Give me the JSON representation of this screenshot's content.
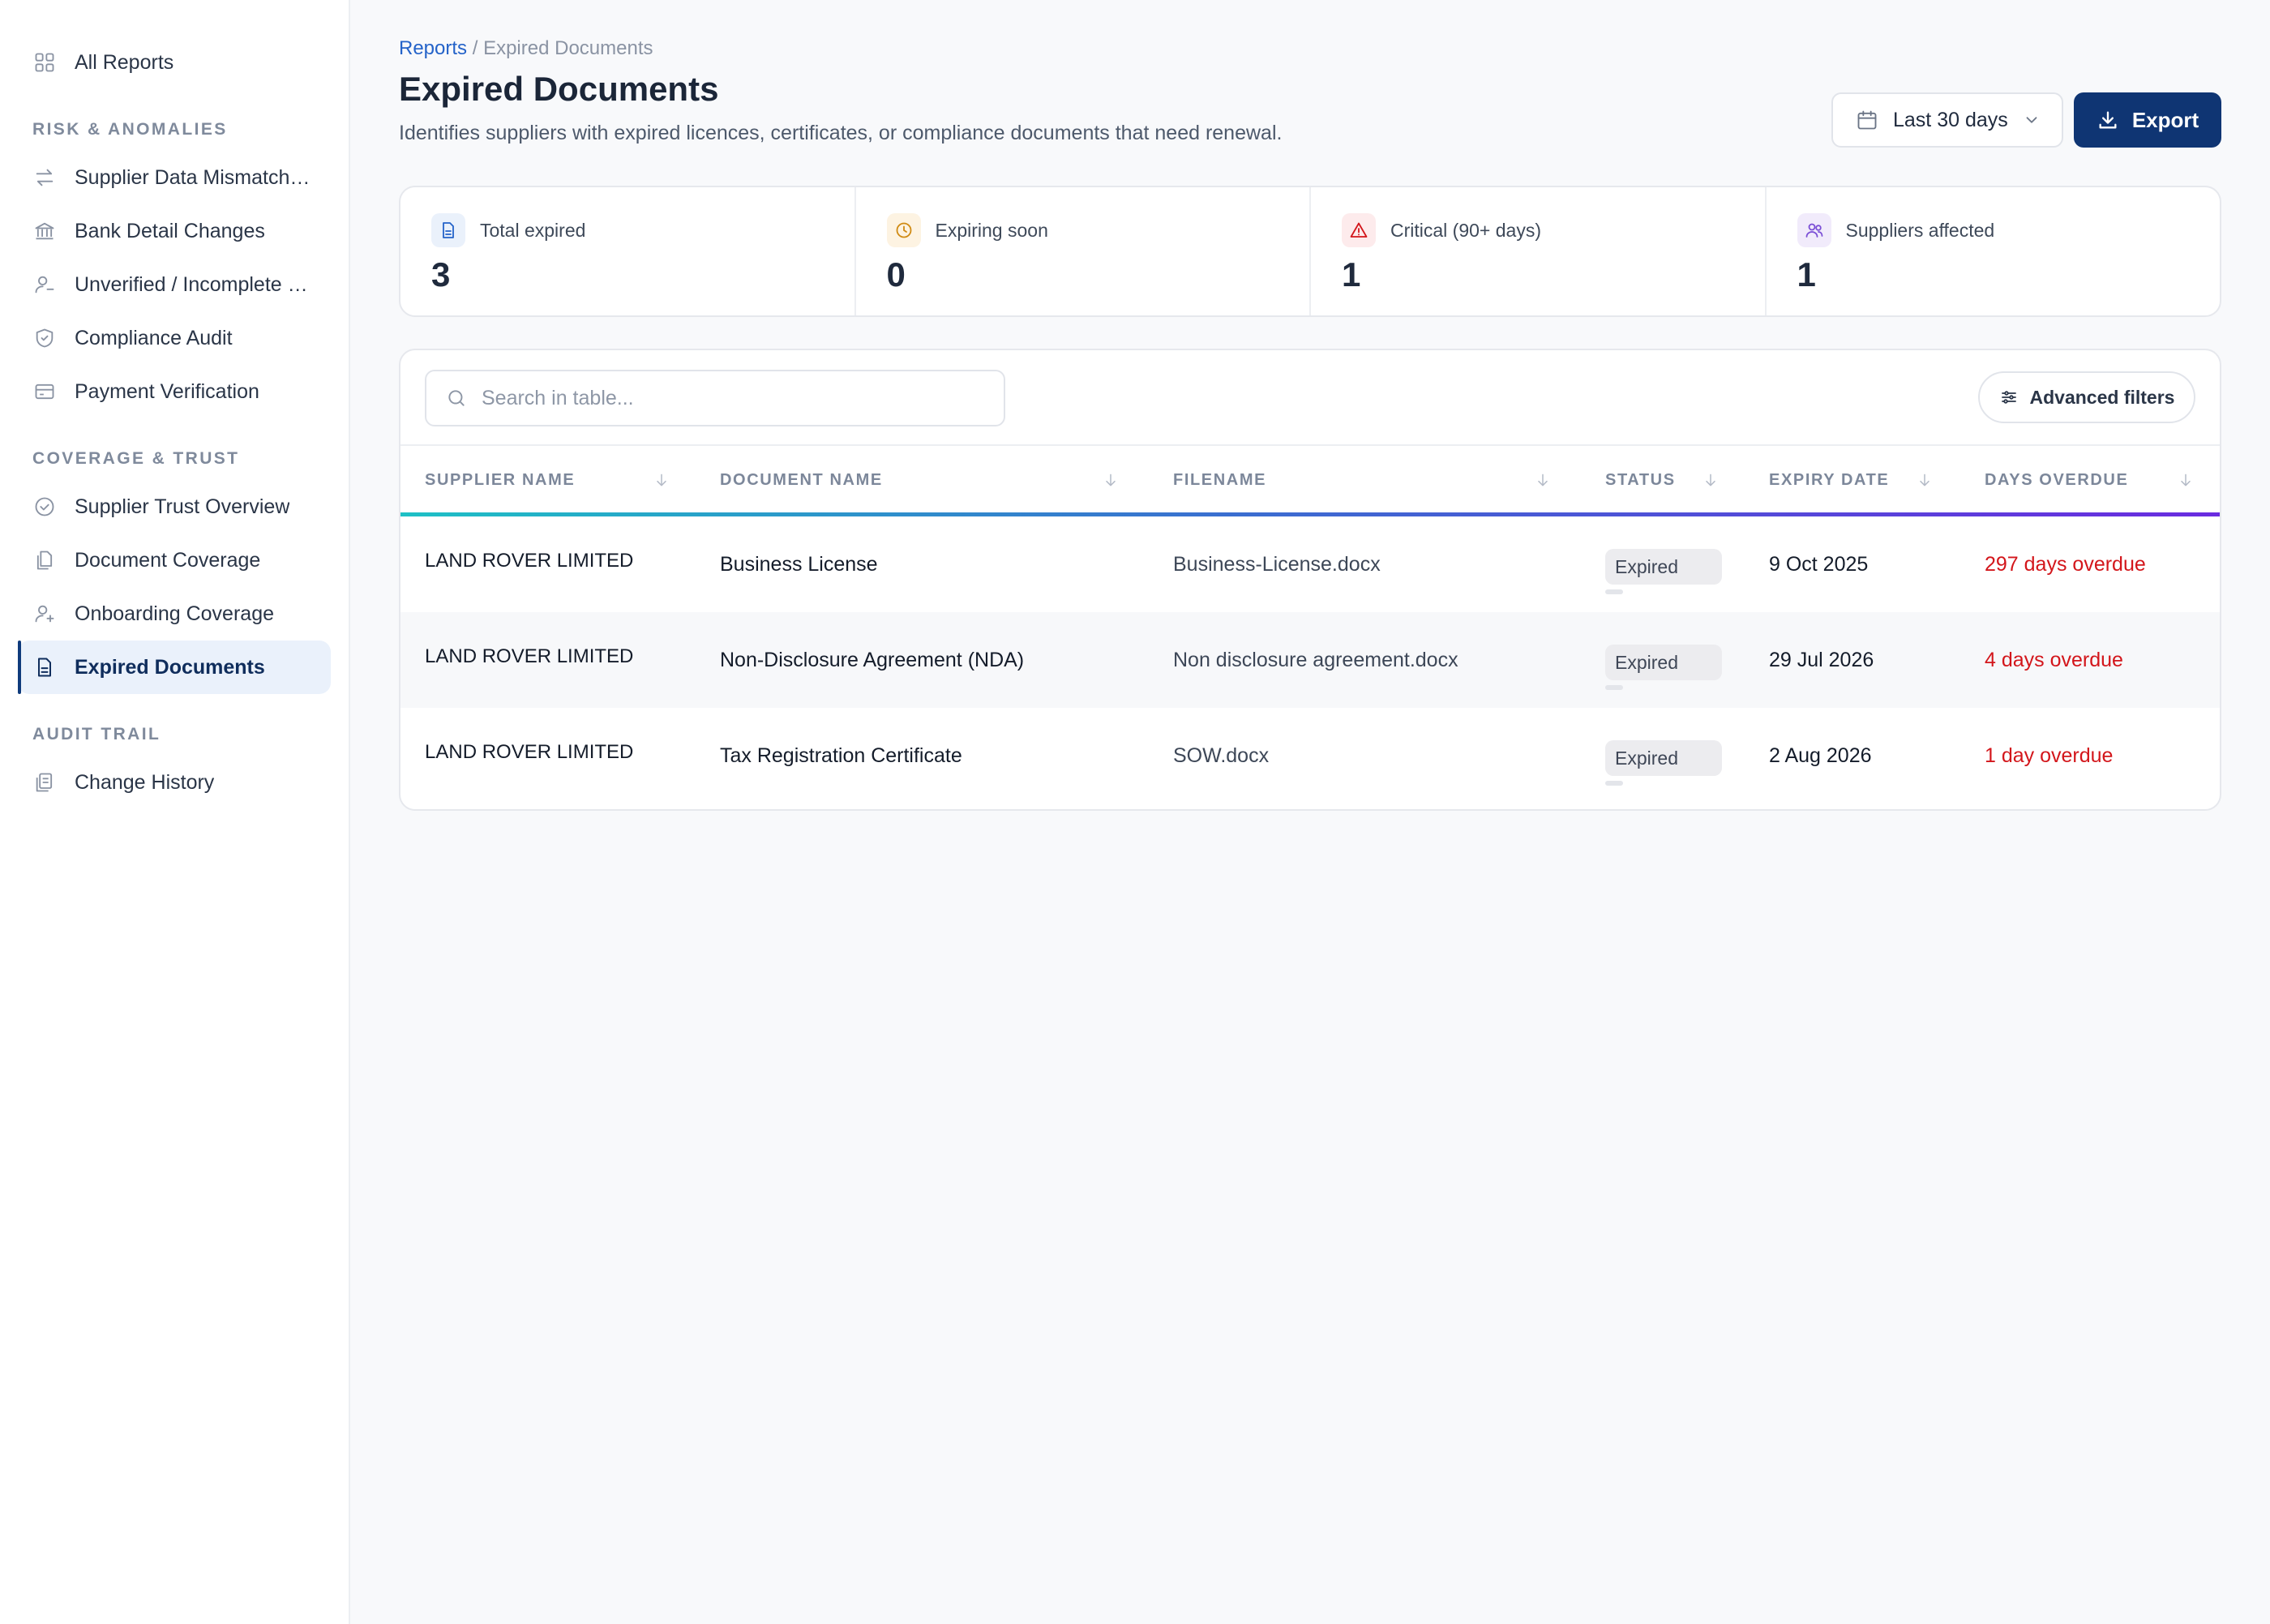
{
  "sidebar": {
    "all_reports": "All Reports",
    "sections": [
      {
        "title": "RISK & ANOMALIES"
      },
      {
        "title": "COVERAGE & TRUST"
      },
      {
        "title": "AUDIT TRAIL"
      }
    ],
    "items": {
      "supplier_mismatch": "Supplier Data Mismatch…",
      "bank_changes": "Bank Detail Changes",
      "unverified": "Unverified / Incomplete …",
      "compliance": "Compliance Audit",
      "payment": "Payment Verification",
      "trust_overview": "Supplier Trust Overview",
      "document_coverage": "Document Coverage",
      "onboarding": "Onboarding Coverage",
      "expired": "Expired Documents",
      "change_history": "Change History"
    }
  },
  "header": {
    "breadcrumb_link": "Reports",
    "breadcrumb_sep": " / ",
    "breadcrumb_current": "Expired Documents",
    "title": "Expired Documents",
    "subtitle": "Identifies suppliers with expired licences, certificates, or compliance documents that need renewal.",
    "date_range": "Last 30 days",
    "export_label": "Export"
  },
  "stats": [
    {
      "label": "Total expired",
      "value": "3",
      "icon": "document-icon",
      "color": "#2463c9"
    },
    {
      "label": "Expiring soon",
      "value": "0",
      "icon": "clock-icon",
      "color": "#d08a12"
    },
    {
      "label": "Critical (90+ days)",
      "value": "1",
      "icon": "warning-icon",
      "color": "#d3161b"
    },
    {
      "label": "Suppliers affected",
      "value": "1",
      "icon": "users-icon",
      "color": "#7b4fd6"
    }
  ],
  "table": {
    "search_placeholder": "Search in table...",
    "advanced_filters": "Advanced filters",
    "columns": [
      "SUPPLIER NAME",
      "DOCUMENT NAME",
      "FILENAME",
      "STATUS",
      "EXPIRY DATE",
      "DAYS OVERDUE"
    ],
    "rows": [
      {
        "supplier": "LAND ROVER LIMITED",
        "document": "Business License",
        "filename": "Business-License.docx",
        "status": "Expired",
        "expiry": "9 Oct 2025",
        "overdue": "297 days overdue"
      },
      {
        "supplier": "LAND ROVER LIMITED",
        "document": "Non-Disclosure Agreement (NDA)",
        "filename": "Non disclosure agreement.docx",
        "status": "Expired",
        "expiry": "29 Jul 2026",
        "overdue": "4 days overdue"
      },
      {
        "supplier": "LAND ROVER LIMITED",
        "document": "Tax Registration Certificate",
        "filename": "SOW.docx",
        "status": "Expired",
        "expiry": "2 Aug 2026",
        "overdue": "1 day overdue"
      }
    ]
  },
  "colors": {
    "accent": "#0f3573",
    "link": "#2463c9",
    "overdue": "#d3161b"
  }
}
